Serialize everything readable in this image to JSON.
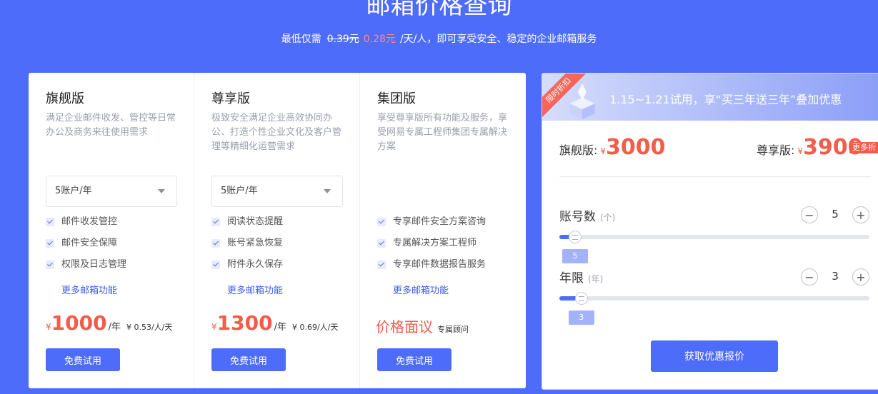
{
  "header": {
    "title": "邮箱价格查询",
    "sub_prefix": "最低仅需",
    "old_price": "0.39元",
    "new_price": "0.28元",
    "sub_suffix": "/天/人，即可享受安全、稳定的企业邮箱服务"
  },
  "plans": [
    {
      "name": "旗舰版",
      "desc": "满足企业邮件收发、管控等日常办公及商务来往使用需求",
      "select": "5账户/年",
      "features": [
        "邮件收发管控",
        "邮件安全保障",
        "权限及日志管理"
      ],
      "more": "更多邮箱功能",
      "currency": "¥",
      "price": "1000",
      "unit": "/年",
      "daily": "¥ 0.53/人/天",
      "button": "免费试用"
    },
    {
      "name": "尊享版",
      "desc": "极致安全满足企业高效协同办公、打造个性企业文化及客户管理等精细化运营需求",
      "select": "5账户/年",
      "features": [
        "阅读状态提醒",
        "账号紧急恢复",
        "附件永久保存"
      ],
      "more": "更多邮箱功能",
      "currency": "¥",
      "price": "1300",
      "unit": "/年",
      "daily": "¥ 0.69/人/天",
      "button": "免费试用"
    },
    {
      "name": "集团版",
      "desc": "享受尊享版所有功能及服务，享受网易专属工程师集团专属解决方案",
      "features": [
        "专享邮件安全方案咨询",
        "专属解决方案工程师",
        "专享邮件数据报告服务"
      ],
      "more": "更多邮箱功能",
      "price_face": "价格面议",
      "consultant": "专属顾问",
      "button": "免费试用"
    }
  ],
  "calculator": {
    "ribbon": "限时折扣",
    "banner": "1.15~1.21试用，享“买三年送三年”叠加优惠",
    "quote1_label": "旗舰版:",
    "quote1_currency": "¥",
    "quote1_value": "3000",
    "quote2_label": "尊享版:",
    "quote2_currency": "¥",
    "quote2_value": "3900",
    "more_tag": "更多折",
    "accounts_label": "账号数",
    "accounts_unit": "(个)",
    "accounts_value": "5",
    "years_label": "年限",
    "years_unit": "(年)",
    "years_value": "3",
    "minus": "−",
    "plus": "+",
    "quote_button": "获取优惠报价",
    "accounts_fill": 0.03,
    "years_fill": 0.05
  }
}
